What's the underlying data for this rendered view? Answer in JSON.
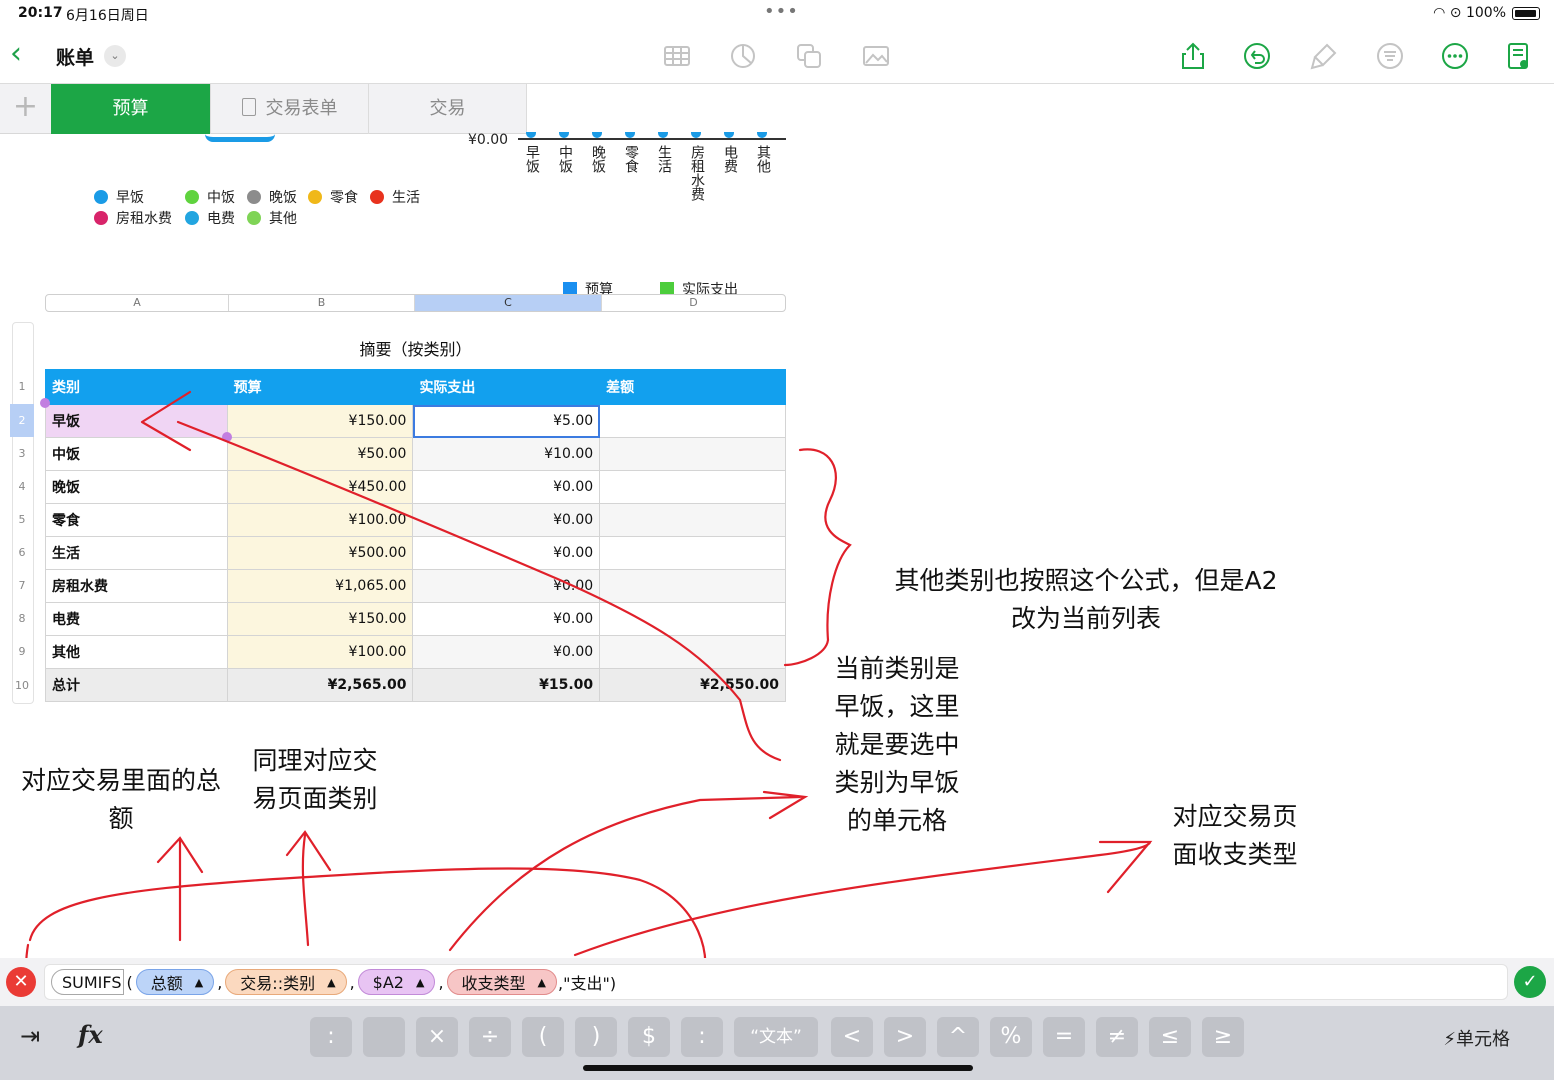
{
  "status_bar": {
    "time": "20:17",
    "date": "6月16日周日",
    "dots": "•••",
    "battery_text": "100%"
  },
  "nav": {
    "back_icon": "chevron-left-icon",
    "document_title": "账单"
  },
  "tabs": {
    "items": [
      {
        "label": "预算",
        "active": true
      },
      {
        "label": "交易表单",
        "active": false
      },
      {
        "label": "交易",
        "active": false
      }
    ]
  },
  "charts": {
    "bar_axis_label": "¥0.00",
    "bar_categories": [
      "早饭",
      "中饭",
      "晚饭",
      "零食",
      "生活",
      "房租水费",
      "电费",
      "其他"
    ],
    "pie_legend": [
      {
        "label": "早饭",
        "color": "#1a9be6"
      },
      {
        "label": "中饭",
        "color": "#5fd33e"
      },
      {
        "label": "晚饭",
        "color": "#8c8c8c"
      },
      {
        "label": "零食",
        "color": "#f0b819"
      },
      {
        "label": "生活",
        "color": "#e8321e"
      },
      {
        "label": "房租水费",
        "color": "#d8246a"
      },
      {
        "label": "电费",
        "color": "#22a5e0"
      },
      {
        "label": "其他",
        "color": "#7fd456"
      }
    ],
    "bar_legend": [
      {
        "label": "预算",
        "color": "#1a8ff0"
      },
      {
        "label": "实际支出",
        "color": "#4ccd3c"
      }
    ]
  },
  "sheet": {
    "column_letters": [
      "A",
      "B",
      "C",
      "D"
    ],
    "row_numbers": [
      "1",
      "2",
      "3",
      "4",
      "5",
      "6",
      "7",
      "8",
      "9",
      "10"
    ],
    "table_title": "摘要（按类别）",
    "headers": [
      "类别",
      "预算",
      "实际支出",
      "差额"
    ],
    "rows": [
      [
        "早饭",
        "¥150.00",
        "¥5.00",
        ""
      ],
      [
        "中饭",
        "¥50.00",
        "¥10.00",
        ""
      ],
      [
        "晚饭",
        "¥450.00",
        "¥0.00",
        ""
      ],
      [
        "零食",
        "¥100.00",
        "¥0.00",
        ""
      ],
      [
        "生活",
        "¥500.00",
        "¥0.00",
        ""
      ],
      [
        "房租水费",
        "¥1,065.00",
        "¥0.00",
        ""
      ],
      [
        "电费",
        "¥150.00",
        "¥0.00",
        ""
      ],
      [
        "其他",
        "¥100.00",
        "¥0.00",
        ""
      ]
    ],
    "total_row": [
      "总计",
      "¥2,565.00",
      "¥15.00",
      "¥2,550.00"
    ]
  },
  "annotations": {
    "other_categories": [
      "其他类别也按照这个公式，但是A2",
      "改为当前列表"
    ],
    "current_category": [
      "当前类别是",
      "早饭，这里",
      "就是要选中",
      "类别为早饭",
      "的单元格"
    ],
    "total_amount": [
      "对应交易里面的总",
      "额"
    ],
    "category_col": [
      "同理对应交",
      "易页面类别"
    ],
    "income_type": [
      "对应交易页",
      "面收支类型"
    ]
  },
  "formula": {
    "function": "SUMIFS",
    "tokens": [
      {
        "label": "总额",
        "style": "blue"
      },
      {
        "label": "交易::类别",
        "style": "orange"
      },
      {
        "label": "$A2",
        "style": "purple"
      },
      {
        "label": "收支类型",
        "style": "red"
      }
    ],
    "literal": ",\"支出\")"
  },
  "keyboard": {
    "keys": [
      ":",
      "",
      "×",
      "÷",
      "(",
      ")",
      "$",
      ":",
      "“文本”",
      "<",
      ">",
      "^",
      "%",
      "=",
      "≠",
      "≤",
      "≥"
    ],
    "cell_label": "单元格",
    "fx_label": "fx",
    "tab_icon": "tab-arrow-icon"
  }
}
